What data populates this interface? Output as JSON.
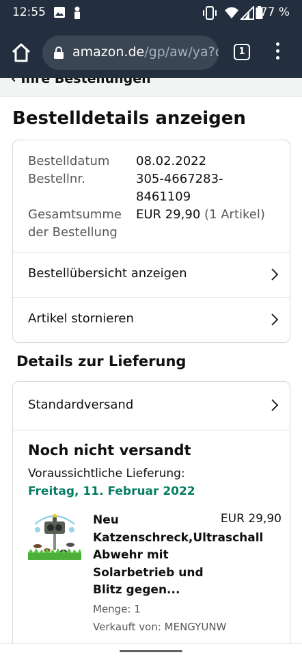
{
  "status_bar": {
    "time": "12:55",
    "battery_pct": "77 %",
    "icons": [
      "image-icon",
      "notification-icon",
      "vibrate-icon",
      "wifi-icon",
      "signal-icon",
      "battery-icon"
    ]
  },
  "browser": {
    "url_domain": "amazon.de",
    "url_path": "/gp/aw/ya?c",
    "tab_count": "1",
    "theme_color": "#232f3e"
  },
  "breadcrumb": "‹ Ihre Bestellungen",
  "page_title": "Bestelldetails anzeigen",
  "order_info": {
    "date_label": "Bestelldatum",
    "date_value": "08.02.2022",
    "number_label": "Bestellnr.",
    "number_value_line1": "305-4667283-",
    "number_value_line2": "8461109",
    "total_label_line1": "Gesamtsumme",
    "total_label_line2": "der Bestellung",
    "total_value": "EUR 29,90",
    "total_items": "(1 Artikel)"
  },
  "actions": [
    {
      "label": "Bestellübersicht anzeigen"
    },
    {
      "label": "Artikel stornieren"
    }
  ],
  "delivery": {
    "section_title": "Details zur Lieferung",
    "shipping_method": "Standardversand",
    "status": "Noch nicht versandt",
    "expected_label": "Voraussichtliche Lieferung:",
    "expected_date": "Freitag, 11. Februar 2022",
    "date_color": "#067d62"
  },
  "product": {
    "title_lines": [
      "Neu",
      "Katzenschreck,Ultraschall",
      "Abwehr mit",
      "Solarbetrieb und",
      "Blitz gegen..."
    ],
    "price": "EUR 29,90",
    "quantity": "Menge: 1",
    "seller": "Verkauft von: MENGYUNW"
  }
}
